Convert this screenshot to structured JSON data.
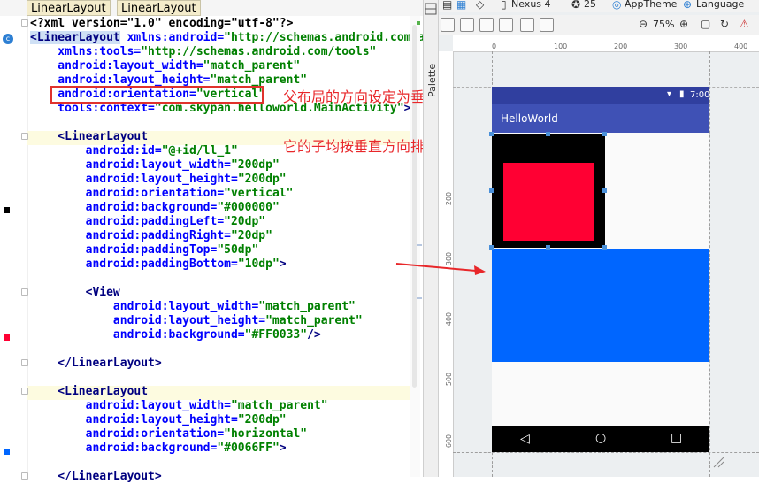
{
  "editor": {
    "tabs": [
      "LinearLayout",
      "LinearLayout"
    ],
    "lines": [
      {
        "parts": [
          [
            "xmlhead",
            "<?xml version=\"1.0\" encoding=\"utf-8\"?>"
          ]
        ]
      },
      {
        "parts": [
          [
            "sel",
            "<LinearLayout"
          ],
          [
            "attr",
            " xmlns:android="
          ],
          [
            "val",
            "\"http://schemas.android.com/ap"
          ]
        ]
      },
      {
        "parts": [
          [
            "attr",
            "    xmlns:tools="
          ],
          [
            "val",
            "\"http://schemas.android.com/tools\""
          ]
        ]
      },
      {
        "parts": [
          [
            "attr",
            "    android:layout_width="
          ],
          [
            "val",
            "\"match_parent\""
          ]
        ]
      },
      {
        "parts": [
          [
            "attr",
            "    android:layout_height="
          ],
          [
            "val",
            "\"match_parent\""
          ]
        ]
      },
      {
        "parts": [
          [
            "attr",
            "    android:orientation="
          ],
          [
            "val",
            "\"vertical\""
          ]
        ]
      },
      {
        "parts": [
          [
            "attr",
            "    tools:context="
          ],
          [
            "val",
            "\"com.skypan.helloworld.MainActivity\""
          ],
          [
            "tag",
            ">"
          ]
        ]
      },
      {
        "parts": [
          [
            "tag",
            ""
          ]
        ]
      },
      {
        "parts": [
          [
            "tag",
            "    <LinearLayout"
          ]
        ]
      },
      {
        "parts": [
          [
            "attr",
            "        android:id="
          ],
          [
            "val",
            "\"@+id/ll_1\""
          ]
        ]
      },
      {
        "parts": [
          [
            "attr",
            "        android:layout_width="
          ],
          [
            "val",
            "\"200dp\""
          ]
        ]
      },
      {
        "parts": [
          [
            "attr",
            "        android:layout_height="
          ],
          [
            "val",
            "\"200dp\""
          ]
        ]
      },
      {
        "parts": [
          [
            "attr",
            "        android:orientation="
          ],
          [
            "val",
            "\"vertical\""
          ]
        ]
      },
      {
        "parts": [
          [
            "attr",
            "        android:background="
          ],
          [
            "val",
            "\"#000000\""
          ]
        ]
      },
      {
        "parts": [
          [
            "attr",
            "        android:paddingLeft="
          ],
          [
            "val",
            "\"20dp\""
          ]
        ]
      },
      {
        "parts": [
          [
            "attr",
            "        android:paddingRight="
          ],
          [
            "val",
            "\"20dp\""
          ]
        ]
      },
      {
        "parts": [
          [
            "attr",
            "        android:paddingTop="
          ],
          [
            "val",
            "\"50dp\""
          ]
        ]
      },
      {
        "parts": [
          [
            "attr",
            "        android:paddingBottom="
          ],
          [
            "val",
            "\"10dp\""
          ],
          [
            "tag",
            ">"
          ]
        ]
      },
      {
        "parts": [
          [
            "tag",
            ""
          ]
        ]
      },
      {
        "parts": [
          [
            "tag",
            "        <View"
          ]
        ]
      },
      {
        "parts": [
          [
            "attr",
            "            android:layout_width="
          ],
          [
            "val",
            "\"match_parent\""
          ]
        ]
      },
      {
        "parts": [
          [
            "attr",
            "            android:layout_height="
          ],
          [
            "val",
            "\"match_parent\""
          ]
        ]
      },
      {
        "parts": [
          [
            "attr",
            "            android:background="
          ],
          [
            "val",
            "\"#FF0033\""
          ],
          [
            "tag",
            "/>"
          ]
        ]
      },
      {
        "parts": [
          [
            "tag",
            ""
          ]
        ]
      },
      {
        "parts": [
          [
            "tag",
            "    </LinearLayout>"
          ]
        ]
      },
      {
        "parts": [
          [
            "tag",
            ""
          ]
        ]
      },
      {
        "parts": [
          [
            "tag",
            "    <LinearLayout"
          ]
        ]
      },
      {
        "parts": [
          [
            "attr",
            "        android:layout_width="
          ],
          [
            "val",
            "\"match_parent\""
          ]
        ]
      },
      {
        "parts": [
          [
            "attr",
            "        android:layout_height="
          ],
          [
            "val",
            "\"200dp\""
          ]
        ]
      },
      {
        "parts": [
          [
            "attr",
            "        android:orientation="
          ],
          [
            "val",
            "\"horizontal\""
          ]
        ]
      },
      {
        "parts": [
          [
            "attr",
            "        android:background="
          ],
          [
            "val",
            "\"#0066FF\""
          ],
          [
            "tag",
            ">"
          ]
        ]
      },
      {
        "parts": [
          [
            "tag",
            ""
          ]
        ]
      },
      {
        "parts": [
          [
            "tag",
            "    </LinearLayout>"
          ]
        ]
      }
    ],
    "gutter_marks": {
      "black": "#000000",
      "red": "#ff0033",
      "blue": "#0066ff"
    }
  },
  "annotations": {
    "line1": "父布局的方向设定为垂直时",
    "line2": "它的子均按垂直方向排列",
    "color": "#e8272a"
  },
  "palette_label": "Palette",
  "designer": {
    "toolbar": {
      "device": "Nexus 4",
      "api": "25",
      "theme": "AppTheme",
      "language": "Language",
      "zoom": "75%"
    },
    "ruler_top": [
      "0",
      "100",
      "200",
      "300",
      "400"
    ],
    "ruler_left": [
      "200",
      "300",
      "400",
      "500",
      "600"
    ],
    "device": {
      "time": "7:00",
      "app_title": "HelloWorld",
      "colors": {
        "status": "#303f9f",
        "appbar": "#3f51b5",
        "black": "#000000",
        "red": "#ff0033",
        "blue": "#0066ff"
      }
    }
  },
  "icons": [
    "palette-tab-icon",
    "design-view-icon",
    "blueprint-icon",
    "orientation-icon",
    "device-icon",
    "api-icon",
    "theme-icon",
    "language-icon",
    "zoom-out-icon",
    "zoom-in-icon",
    "wifi-icon",
    "battery-icon",
    "back-icon",
    "home-icon",
    "recents-icon",
    "resize-grip-icon",
    "arrow-icon"
  ]
}
